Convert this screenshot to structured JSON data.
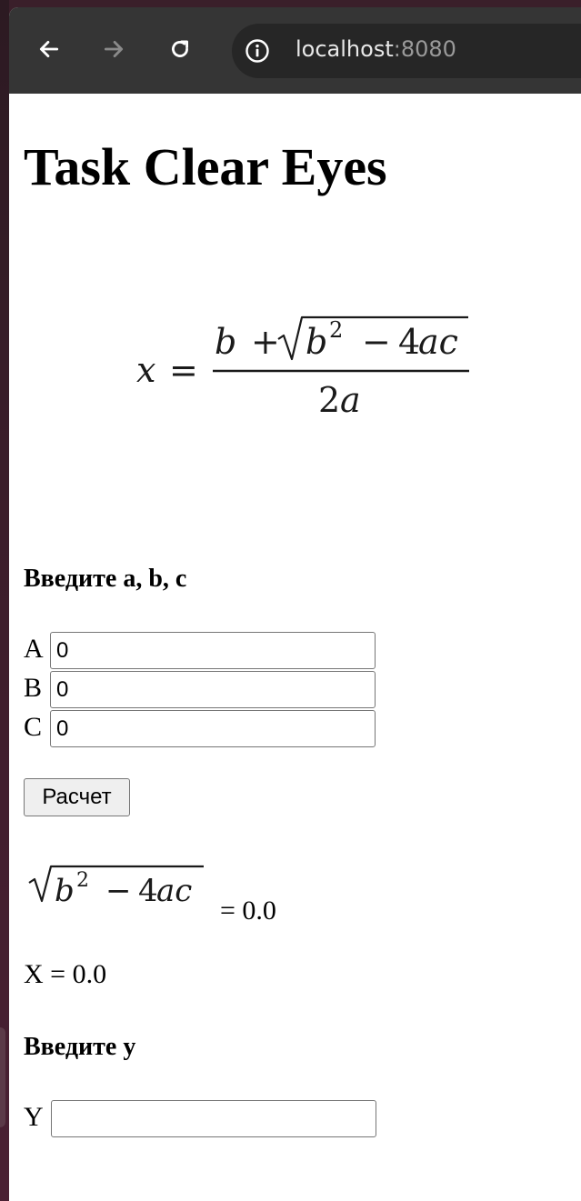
{
  "browser": {
    "url_host": "localhost",
    "url_port": ":8080"
  },
  "page": {
    "title": "Task Clear Eyes",
    "formula_main": "x = (b + √(b² − 4ac)) / 2a",
    "inputs_heading": "Введите a, b, c",
    "fields": [
      {
        "label": "A",
        "value": "0"
      },
      {
        "label": "B",
        "value": "0"
      },
      {
        "label": "C",
        "value": "0"
      }
    ],
    "calc_button_label": "Расчет",
    "discriminant_formula": "√(b² − 4ac)",
    "discriminant_result": "= 0.0",
    "x_result": "X = 0.0",
    "y_heading": "Введите y",
    "y_field": {
      "label": "Y",
      "value": ""
    }
  }
}
